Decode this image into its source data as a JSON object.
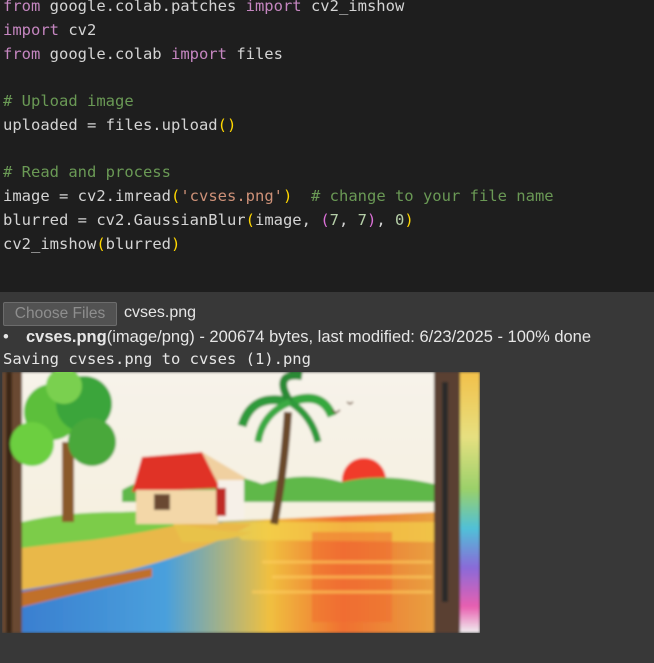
{
  "code": {
    "l1": {
      "a": "from",
      "b": " google.colab.patches ",
      "c": "import",
      "d": " cv2_imshow"
    },
    "l2": {
      "a": "import",
      "b": " cv2"
    },
    "l3": {
      "a": "from",
      "b": " google.colab ",
      "c": "import",
      "d": " files"
    },
    "l4": {
      "comment": "# Upload image"
    },
    "l5": {
      "a": "uploaded = files.upload",
      "b": "(",
      "c": ")"
    },
    "l6": {
      "comment": "# Read and process"
    },
    "l7": {
      "a": "image = cv2.imread",
      "b": "(",
      "c": "'cvses.png'",
      "d": ")",
      "e": "  # change to your file name"
    },
    "l8": {
      "a": "blurred = cv2.GaussianBlur",
      "b": "(",
      "c": "image, ",
      "d": "(",
      "e": "7",
      "f": ", ",
      "g": "7",
      "h": ")",
      "i": ", ",
      "j": "0",
      "k": ")"
    },
    "l9": {
      "a": "cv2_imshow",
      "b": "(",
      "c": "blurred",
      "d": ")"
    }
  },
  "output": {
    "choose_files_label": "Choose Files",
    "selected_file": "cvses.png",
    "upload_bullet_name": "cvses.png",
    "upload_bullet_detail": "(image/png) - 200674 bytes, last modified: 6/23/2025 - 100% done",
    "saving_text": "Saving cvses.png to cvses (1).png"
  },
  "colors": {
    "code_bg": "#1e1e1e",
    "output_bg": "#383838",
    "keyword": "#c586c0",
    "comment": "#6a9955",
    "string": "#ce9178",
    "number": "#b5cea8",
    "bracket": "#ffd700"
  }
}
